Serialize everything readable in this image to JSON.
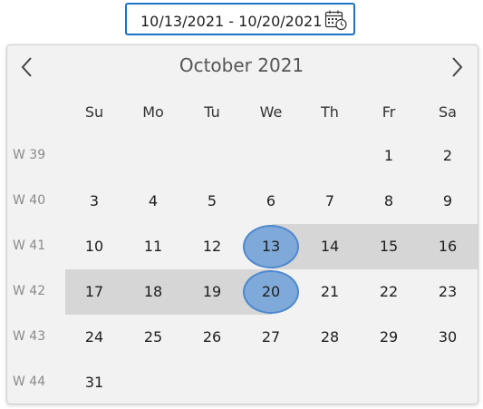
{
  "date_range": {
    "value": "10/13/2021 - 10/20/2021",
    "icon": "calendar-clock-icon"
  },
  "calendar": {
    "month_title": "October 2021",
    "prev_icon": "chevron-left-icon",
    "next_icon": "chevron-right-icon",
    "weekdays": [
      "Su",
      "Mo",
      "Tu",
      "We",
      "Th",
      "Fr",
      "Sa"
    ],
    "weeks": [
      {
        "label": "W 39",
        "days": [
          "",
          "",
          "",
          "",
          "",
          "1",
          "2"
        ]
      },
      {
        "label": "W 40",
        "days": [
          "3",
          "4",
          "5",
          "6",
          "7",
          "8",
          "9"
        ]
      },
      {
        "label": "W 41",
        "days": [
          "10",
          "11",
          "12",
          "13",
          "14",
          "15",
          "16"
        ]
      },
      {
        "label": "W 42",
        "days": [
          "17",
          "18",
          "19",
          "20",
          "21",
          "22",
          "23"
        ]
      },
      {
        "label": "W 43",
        "days": [
          "24",
          "25",
          "26",
          "27",
          "28",
          "29",
          "30"
        ]
      },
      {
        "label": "W 44",
        "days": [
          "31",
          "",
          "",
          "",
          "",
          "",
          ""
        ]
      }
    ],
    "range_start": "13",
    "range_end": "20",
    "colors": {
      "accent": "#1a73c5",
      "selected_fill": "#7fa9d8",
      "selected_border": "#4e88cf",
      "range_band": "#d6d6d6",
      "popup_bg": "#f2f2f2"
    }
  }
}
